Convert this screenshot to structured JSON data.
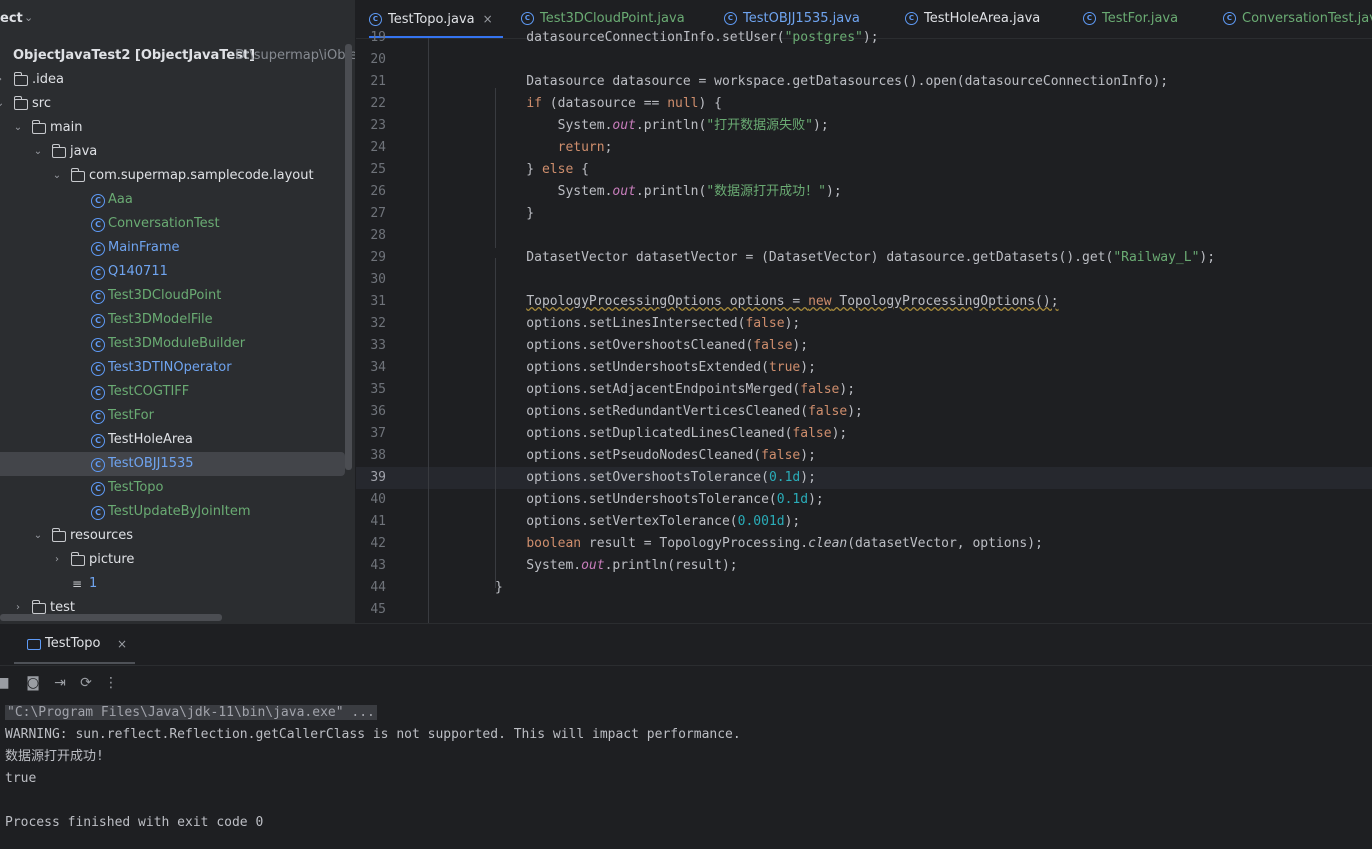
{
  "project": {
    "title": "ect",
    "tree": [
      {
        "indent": 0,
        "arrow": "",
        "icon": "module",
        "label": "ObjectJavaTest2 [ObjectJavaTest]",
        "hint": "D:\\supermap\\iObjec",
        "color": "",
        "selected": false
      },
      {
        "indent": 0,
        "arrow": "›",
        "icon": "folder",
        "label": ".idea",
        "color": "",
        "selected": false
      },
      {
        "indent": 0,
        "arrow": "⌄",
        "icon": "folder",
        "label": "src",
        "color": "",
        "selected": false
      },
      {
        "indent": 1,
        "arrow": "⌄",
        "icon": "folder",
        "label": "main",
        "color": "",
        "selected": false
      },
      {
        "indent": 2,
        "arrow": "⌄",
        "icon": "folder",
        "label": "java",
        "color": "",
        "selected": false
      },
      {
        "indent": 3,
        "arrow": "⌄",
        "icon": "package",
        "label": "com.supermap.samplecode.layout",
        "color": "",
        "selected": false
      },
      {
        "indent": 4,
        "arrow": "",
        "icon": "class",
        "label": "Aaa",
        "color": "green",
        "selected": false
      },
      {
        "indent": 4,
        "arrow": "",
        "icon": "class",
        "label": "ConversationTest",
        "color": "green",
        "selected": false
      },
      {
        "indent": 4,
        "arrow": "",
        "icon": "class",
        "label": "MainFrame",
        "color": "blue",
        "selected": false
      },
      {
        "indent": 4,
        "arrow": "",
        "icon": "class",
        "label": "Q140711",
        "color": "blue",
        "selected": false
      },
      {
        "indent": 4,
        "arrow": "",
        "icon": "class",
        "label": "Test3DCloudPoint",
        "color": "green",
        "selected": false
      },
      {
        "indent": 4,
        "arrow": "",
        "icon": "class",
        "label": "Test3DModelFile",
        "color": "green",
        "selected": false
      },
      {
        "indent": 4,
        "arrow": "",
        "icon": "class",
        "label": "Test3DModuleBuilder",
        "color": "green",
        "selected": false
      },
      {
        "indent": 4,
        "arrow": "",
        "icon": "class",
        "label": "Test3DTINOperator",
        "color": "blue",
        "selected": false
      },
      {
        "indent": 4,
        "arrow": "",
        "icon": "class",
        "label": "TestCOGTIFF",
        "color": "green",
        "selected": false
      },
      {
        "indent": 4,
        "arrow": "",
        "icon": "class",
        "label": "TestFor",
        "color": "green",
        "selected": false
      },
      {
        "indent": 4,
        "arrow": "",
        "icon": "class",
        "label": "TestHoleArea",
        "color": "",
        "selected": false
      },
      {
        "indent": 4,
        "arrow": "",
        "icon": "class",
        "label": "TestOBJJ1535",
        "color": "blue",
        "selected": true
      },
      {
        "indent": 4,
        "arrow": "",
        "icon": "class",
        "label": "TestTopo",
        "color": "green",
        "selected": false
      },
      {
        "indent": 4,
        "arrow": "",
        "icon": "class",
        "label": "TestUpdateByJoinItem",
        "color": "green",
        "selected": false
      },
      {
        "indent": 2,
        "arrow": "⌄",
        "icon": "resfolder",
        "label": "resources",
        "color": "",
        "selected": false
      },
      {
        "indent": 3,
        "arrow": "›",
        "icon": "folder",
        "label": "picture",
        "color": "",
        "selected": false
      },
      {
        "indent": 3,
        "arrow": "",
        "icon": "textfile",
        "label": "1",
        "color": "blue",
        "selected": false
      },
      {
        "indent": 1,
        "arrow": "›",
        "icon": "folder",
        "label": "test",
        "color": "",
        "selected": false
      }
    ]
  },
  "tabs": [
    {
      "label": "TestTopo.java",
      "active": true,
      "color": "",
      "close": "×"
    },
    {
      "label": "Test3DCloudPoint.java",
      "active": false,
      "color": "green"
    },
    {
      "label": "TestOBJJ1535.java",
      "active": false,
      "color": "blue"
    },
    {
      "label": "TestHoleArea.java",
      "active": false,
      "color": ""
    },
    {
      "label": "TestFor.java",
      "active": false,
      "color": "green"
    },
    {
      "label": "ConversationTest.java",
      "active": false,
      "color": "green"
    }
  ],
  "code": [
    {
      "n": "19",
      "html": "    datasourceConnectionInfo.setUser(<span class=\"str\">\"postgres\"</span>);"
    },
    {
      "n": "20",
      "html": ""
    },
    {
      "n": "21",
      "html": "    Datasource datasource = workspace.getDatasources().open(datasourceConnectionInfo);"
    },
    {
      "n": "22",
      "html": "    <span class=\"kw\">if</span> (datasource == <span class=\"kw\">null</span>) {"
    },
    {
      "n": "23",
      "html": "        System.<span class=\"fld\">out</span>.println(<span class=\"str\">\"打开数据源失败\"</span>);"
    },
    {
      "n": "24",
      "html": "        <span class=\"kw\">return</span>;"
    },
    {
      "n": "25",
      "html": "    } <span class=\"kw\">else</span> {"
    },
    {
      "n": "26",
      "html": "        System.<span class=\"fld\">out</span>.println(<span class=\"str\">\"数据源打开成功！\"</span>);"
    },
    {
      "n": "27",
      "html": "    }"
    },
    {
      "n": "28",
      "html": ""
    },
    {
      "n": "29",
      "html": "    DatasetVector datasetVector = (DatasetVector) datasource.getDatasets().get(<span class=\"str\">\"Railway_L\"</span>);"
    },
    {
      "n": "30",
      "html": ""
    },
    {
      "n": "31",
      "html": "    <span class=\"wavy\">TopologyProcessingOptions options = <span class=\"kw\">new</span> TopologyProcessingOptions();</span>"
    },
    {
      "n": "32",
      "html": "    options.setLinesIntersected(<span class=\"kw\">false</span>);"
    },
    {
      "n": "33",
      "html": "    options.setOvershootsCleaned(<span class=\"kw\">false</span>);"
    },
    {
      "n": "34",
      "html": "    options.setUndershootsExtended(<span class=\"kw\">true</span>);"
    },
    {
      "n": "35",
      "html": "    options.setAdjacentEndpointsMerged(<span class=\"kw\">false</span>);"
    },
    {
      "n": "36",
      "html": "    options.setRedundantVerticesCleaned(<span class=\"kw\">false</span>);"
    },
    {
      "n": "37",
      "html": "    options.setDuplicatedLinesCleaned(<span class=\"kw\">false</span>);"
    },
    {
      "n": "38",
      "html": "    options.setPseudoNodesCleaned(<span class=\"kw\">false</span>);"
    },
    {
      "n": "39",
      "html": "    options.setOvershootsTolerance(<span class=\"num\">0.1d</span>);",
      "current": true
    },
    {
      "n": "40",
      "html": "    options.setUndershootsTolerance(<span class=\"num\">0.1d</span>);"
    },
    {
      "n": "41",
      "html": "    options.setVertexTolerance(<span class=\"num\">0.001d</span>);"
    },
    {
      "n": "42",
      "html": "    <span class=\"kw\">boolean</span> result = TopologyProcessing.<span class=\"ital\">clean</span>(datasetVector, options);"
    },
    {
      "n": "43",
      "html": "    System.<span class=\"fld\">out</span>.println(result);"
    },
    {
      "n": "44",
      "html": "}"
    },
    {
      "n": "45",
      "html": ""
    }
  ],
  "run": {
    "tab_label": "TestTopo",
    "tab_close": "×",
    "toolbar_icons": [
      "stop-icon",
      "camera-icon",
      "exit-icon",
      "restart-icon",
      "more-icon"
    ],
    "console": [
      {
        "text": "\"C:\\Program Files\\Java\\jdk-11\\bin\\java.exe\" ...",
        "cmd": true
      },
      {
        "text": "WARNING: sun.reflect.Reflection.getCallerClass is not supported. This will impact performance."
      },
      {
        "text": "数据源打开成功!"
      },
      {
        "text": "true"
      },
      {
        "text": ""
      },
      {
        "text": "Process finished with exit code 0"
      }
    ]
  }
}
